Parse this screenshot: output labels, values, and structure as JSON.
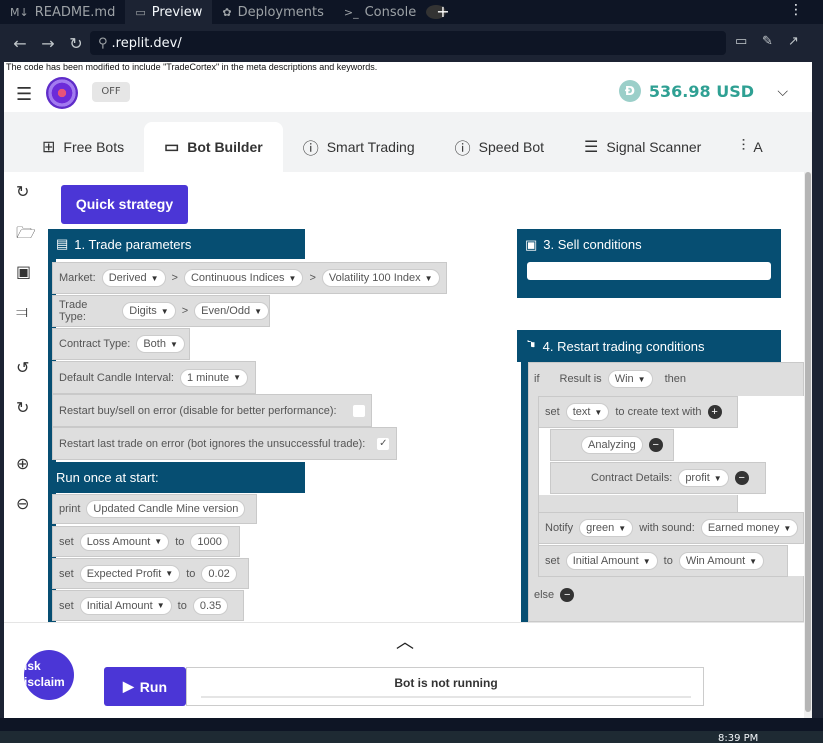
{
  "browser": {
    "tabs": [
      {
        "label": "README.md",
        "icon": "markdown-icon"
      },
      {
        "label": "Preview",
        "icon": "monitor-icon"
      },
      {
        "label": "Deployments",
        "icon": "deploy-icon"
      },
      {
        "label": "Console",
        "icon": "terminal-icon"
      }
    ],
    "plus": "+",
    "more": "⋮",
    "url": ".replit.dev/"
  },
  "notice": "The code has been modified to include \"TradeCortex\" in the meta descriptions and keywords.",
  "header": {
    "toggle_label": "OFF",
    "balance": "536.98 USD",
    "currency_icon": "Ð"
  },
  "tabs": [
    {
      "label": "Free Bots",
      "icon": "⊞"
    },
    {
      "label": "Bot Builder",
      "icon": "▭"
    },
    {
      "label": "Smart Trading",
      "icon": "ⓘ"
    },
    {
      "label": "Speed Bot",
      "icon": "ⓘ"
    },
    {
      "label": "Signal Scanner",
      "icon": "☰"
    },
    {
      "label": "A",
      "icon": "⫶"
    }
  ],
  "workspace": {
    "quick_strategy": "Quick strategy",
    "trade_params": {
      "title": "1. Trade parameters",
      "market_label": "Market:",
      "market": [
        "Derived",
        "Continuous Indices",
        "Volatility 100 Index"
      ],
      "trade_type_label": "Trade Type:",
      "trade_type": [
        "Digits",
        "Even/Odd"
      ],
      "contract_type_label": "Contract Type:",
      "contract_type": "Both",
      "candle_label": "Default Candle Interval:",
      "candle": "1 minute",
      "restart_error_label": "Restart buy/sell on error (disable for better performance):",
      "restart_last_label": "Restart last trade on error (bot ignores the unsuccessful trade):",
      "check": "✓"
    },
    "run_once": {
      "title": "Run once at start:",
      "print_label": "print",
      "print_text": "Updated Candle Mine version",
      "set_label": "set",
      "to_label": "to",
      "vars": [
        {
          "name": "Loss Amount",
          "value": "1000"
        },
        {
          "name": "Expected Profit",
          "value": "0.02"
        },
        {
          "name": "Initial Amount",
          "value": "0.35"
        }
      ]
    },
    "sell": {
      "title": "3. Sell conditions"
    },
    "restart": {
      "title": "4. Restart trading conditions",
      "if_label": "if",
      "result_label": "Result is",
      "result_value": "Win",
      "then_label": "then",
      "set_label": "set",
      "text_value": "text",
      "create_text": "to create text with",
      "analyzing": "Analyzing",
      "contract_details_label": "Contract Details:",
      "contract_details_value": "profit",
      "notify_label": "Notify",
      "notify_color": "green",
      "sound_label": "with sound:",
      "sound_value": "Earned money",
      "set2_var": "Initial Amount",
      "to_label": "to",
      "set2_value": "Win Amount",
      "else_label": "else"
    }
  },
  "bottom": {
    "caret": "︿",
    "run_label": "Run",
    "status_text": "Bot is not running",
    "risk_text": "isk isclaim"
  },
  "desktop": {
    "clock": "8:39 PM"
  }
}
